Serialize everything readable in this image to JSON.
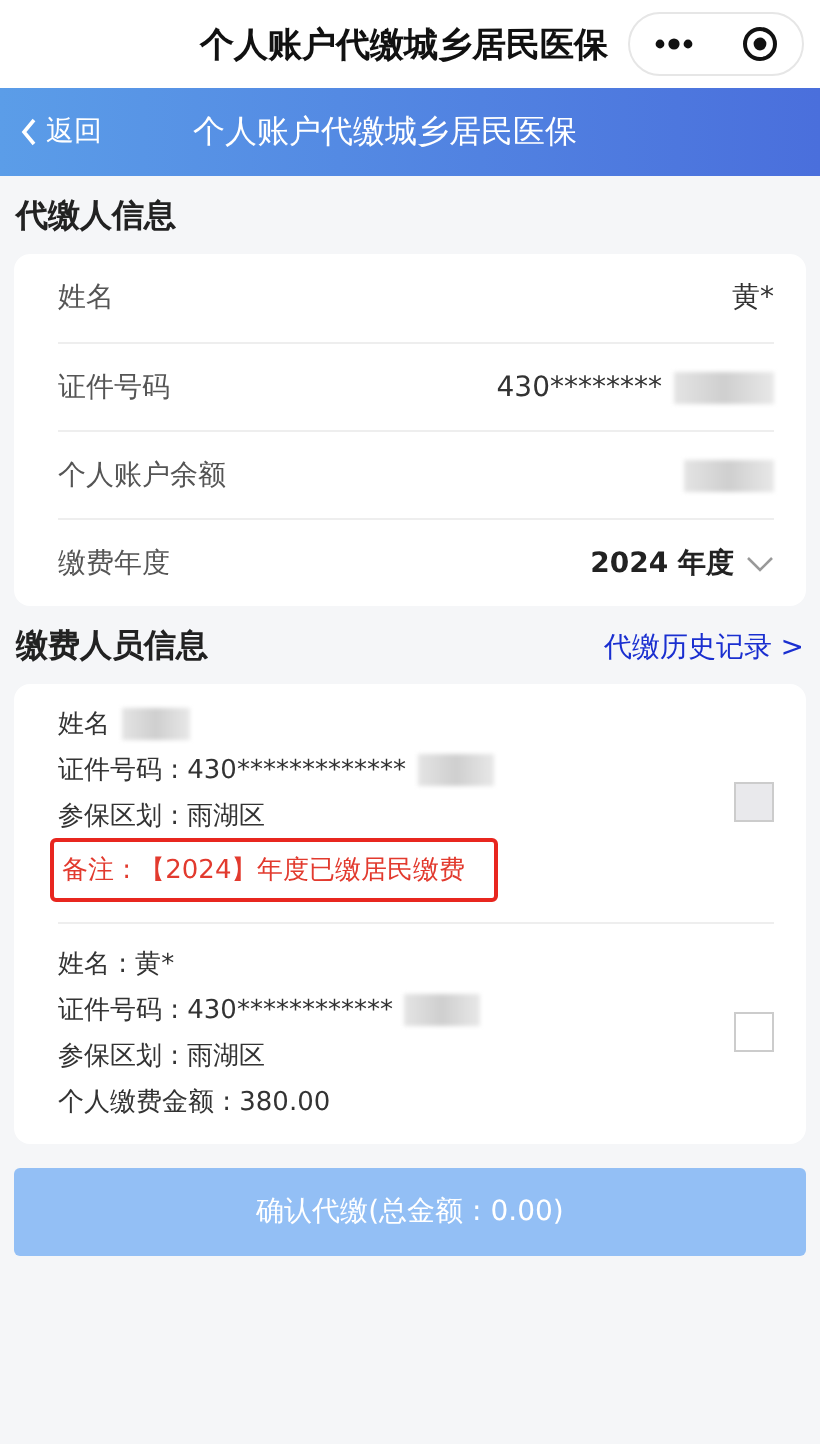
{
  "mini_bar": {
    "title": "个人账户代缴城乡居民医保"
  },
  "header": {
    "back": "返回",
    "title": "个人账户代缴城乡居民医保"
  },
  "payer_section": {
    "title": "代缴人信息"
  },
  "payer_rows": [
    {
      "kind": "text",
      "label": "姓名",
      "value": "黄*",
      "redacted": false
    },
    {
      "kind": "text",
      "label": "证件号码",
      "value": "430********",
      "redacted": true
    },
    {
      "kind": "text",
      "label": "个人账户余额",
      "redacted": true
    },
    {
      "kind": "select",
      "label": "缴费年度",
      "value": "2024 年度"
    }
  ],
  "members_section": {
    "title": "缴费人员信息",
    "link": "代缴历史记录 >"
  },
  "members": [
    {
      "lines": [
        {
          "text": "姓名",
          "redacted": true
        },
        {
          "text": "证件号码 : 430*************",
          "redacted": true
        },
        {
          "text": "参保区划 : 雨湖区",
          "redacted": false
        }
      ],
      "note": "备注 : 【2024】年度已缴居民缴费",
      "note_highlighted": true,
      "disabled": true,
      "checked": false
    },
    {
      "lines": [
        {
          "text": "姓名 : 黄*",
          "redacted": false
        },
        {
          "text": "证件号码 : 430************",
          "redacted": true
        },
        {
          "text": "参保区划 : 雨湖区",
          "redacted": false
        },
        {
          "text": "个人缴费金额 : 380.00",
          "redacted": false
        }
      ],
      "disabled": false,
      "checked": false
    }
  ],
  "confirm_button": {
    "label": "确认代缴(总金额 : 0.00)",
    "disabled": true
  }
}
